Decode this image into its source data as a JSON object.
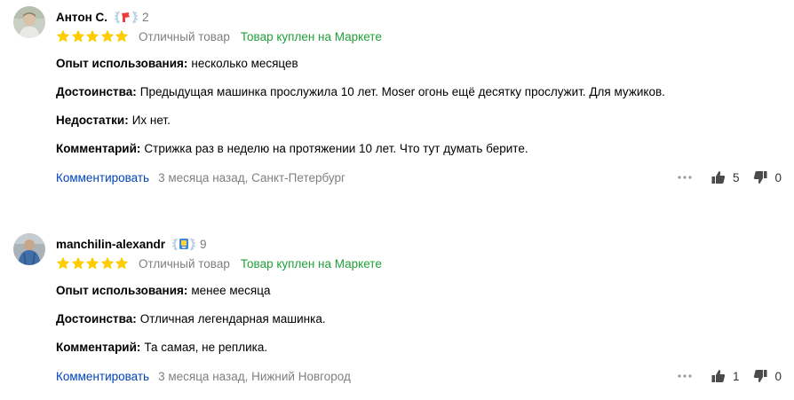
{
  "reviews": [
    {
      "author": "Антон С.",
      "badge_count": "2",
      "rating_text": "Отличный товар",
      "bought_text": "Товар куплен на Маркете",
      "fields": [
        {
          "label": "Опыт использования:",
          "value": "несколько месяцев"
        },
        {
          "label": "Достоинства:",
          "value": "Предыдущая машинка прослужила 10 лет. Moser огонь ещё десятку прослужит. Для мужиков."
        },
        {
          "label": "Недостатки:",
          "value": "Их нет."
        },
        {
          "label": "Комментарий:",
          "value": "Стрижка раз в неделю на протяжении 10 лет. Что тут думать берите."
        }
      ],
      "comment_label": "Комментировать",
      "meta": "3 месяца назад, Санкт-Петербург",
      "likes": "5",
      "dislikes": "0",
      "stars": 5
    },
    {
      "author": "manchilin-alexandr",
      "badge_count": "9",
      "rating_text": "Отличный товар",
      "bought_text": "Товар куплен на Маркете",
      "fields": [
        {
          "label": "Опыт использования:",
          "value": "менее месяца"
        },
        {
          "label": "Достоинства:",
          "value": "Отличная легендарная машинка."
        },
        {
          "label": "Комментарий:",
          "value": "Та самая, не реплика."
        }
      ],
      "comment_label": "Комментировать",
      "meta": "3 месяца назад, Нижний Новгород",
      "likes": "1",
      "dislikes": "0",
      "stars": 5
    }
  ],
  "colors": {
    "star": "#ffcc00",
    "bought": "#21a038",
    "link": "#0044bb",
    "muted": "#7f7f7f"
  },
  "icons": {
    "avatar_1": "user-photo-avatar",
    "avatar_2": "user-photo-avatar",
    "badge_1": "laurel-hairdryer-badge-icon",
    "badge_2": "laurel-trophy-badge-icon",
    "more": "more-dots-icon",
    "like": "thumbs-up-icon",
    "dislike": "thumbs-down-icon"
  }
}
